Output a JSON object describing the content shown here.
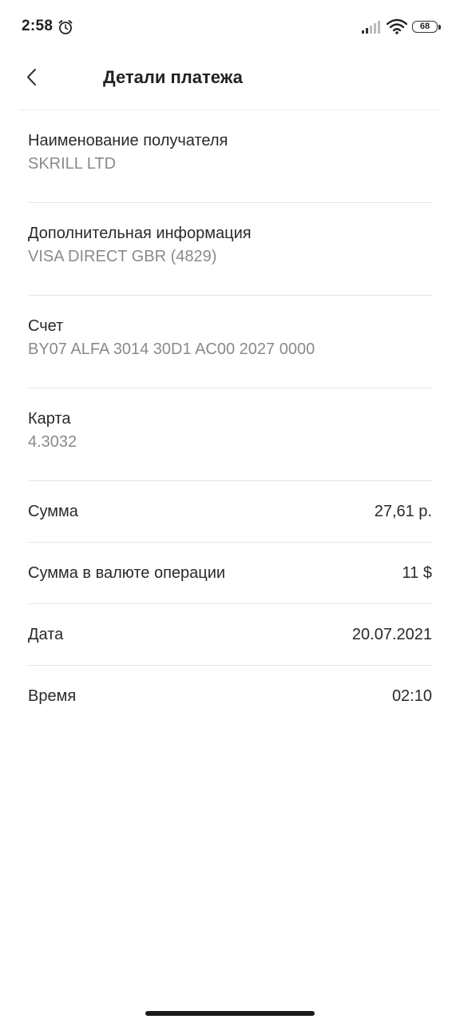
{
  "status_bar": {
    "time": "2:58",
    "battery": "68"
  },
  "header": {
    "title": "Детали платежа"
  },
  "details": {
    "recipient": {
      "label": "Наименование получателя",
      "value": "SKRILL LTD"
    },
    "additional_info": {
      "label": "Дополнительная информация",
      "value": "VISA DIRECT GBR (4829)"
    },
    "account": {
      "label": "Счет",
      "value": "BY07 ALFA 3014 30D1 AC00 2027 0000"
    },
    "card": {
      "label": "Карта",
      "value": "4.3032"
    }
  },
  "rows": {
    "amount": {
      "label": "Сумма",
      "value": "27,61 р."
    },
    "amount_currency": {
      "label": "Сумма в валюте операции",
      "value": "11 $"
    },
    "date": {
      "label": "Дата",
      "value": "20.07.2021"
    },
    "time": {
      "label": "Время",
      "value": "02:10"
    }
  },
  "icons": {
    "back": "chevron-left-icon",
    "alarm": "alarm-icon",
    "signal": "signal-icon",
    "wifi": "wifi-icon",
    "battery": "battery-icon"
  }
}
